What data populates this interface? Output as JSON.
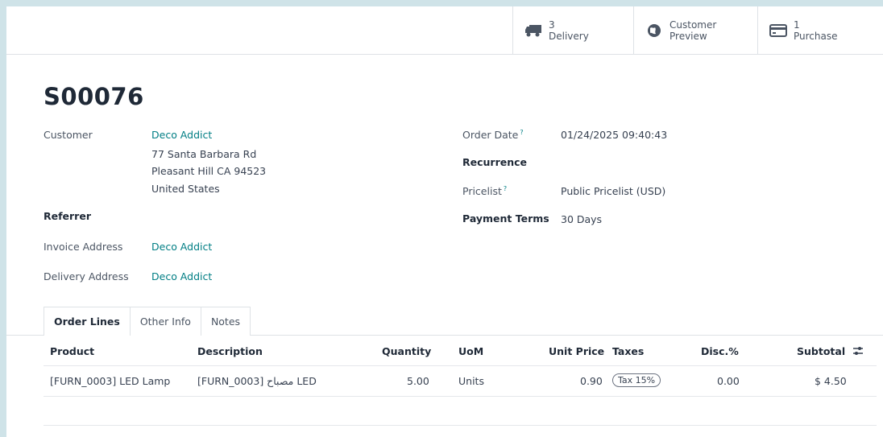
{
  "smart_buttons": {
    "delivery": {
      "count": "3",
      "label": "Delivery"
    },
    "preview": {
      "line1": "Customer",
      "line2": "Preview"
    },
    "purchase": {
      "count": "1",
      "label": "Purchase"
    }
  },
  "record": {
    "title": "S00076"
  },
  "left_fields": {
    "customer_label": "Customer",
    "customer_name": "Deco Addict",
    "address_line1": "77 Santa Barbara Rd",
    "address_line2": "Pleasant Hill CA 94523",
    "address_line3": "United States",
    "referrer_label": "Referrer",
    "invoice_label": "Invoice Address",
    "invoice_value": "Deco Addict",
    "delivery_label": "Delivery Address",
    "delivery_value": "Deco Addict"
  },
  "right_fields": {
    "order_date_label": "Order Date",
    "order_date_value": "01/24/2025 09:40:43",
    "recurrence_label": "Recurrence",
    "pricelist_label": "Pricelist",
    "pricelist_value": "Public Pricelist (USD)",
    "payment_terms_label": "Payment Terms",
    "payment_terms_value": "30 Days",
    "help_mark": "?"
  },
  "tabs": [
    "Order Lines",
    "Other Info",
    "Notes"
  ],
  "table": {
    "headers": [
      "Product",
      "Description",
      "Quantity",
      "UoM",
      "Unit Price",
      "Taxes",
      "Disc.%",
      "Subtotal"
    ],
    "rows": [
      {
        "product": "[FURN_0003] LED Lamp",
        "description": "[FURN_0003] مصباح LED",
        "quantity": "5.00",
        "uom": "Units",
        "unit_price": "0.90",
        "taxes": "Tax 15%",
        "discount": "0.00",
        "subtotal": "$ 4.50"
      }
    ]
  },
  "colors": {
    "accent": "#017e84",
    "background": "#cfe3e8"
  }
}
